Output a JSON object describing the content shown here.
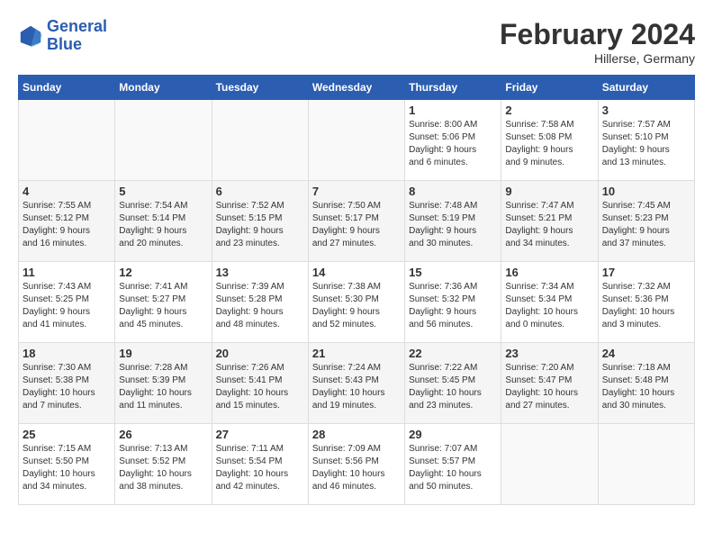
{
  "header": {
    "logo_line1": "General",
    "logo_line2": "Blue",
    "month": "February 2024",
    "location": "Hillerse, Germany"
  },
  "days_of_week": [
    "Sunday",
    "Monday",
    "Tuesday",
    "Wednesday",
    "Thursday",
    "Friday",
    "Saturday"
  ],
  "weeks": [
    [
      {
        "day": "",
        "info": ""
      },
      {
        "day": "",
        "info": ""
      },
      {
        "day": "",
        "info": ""
      },
      {
        "day": "",
        "info": ""
      },
      {
        "day": "1",
        "info": "Sunrise: 8:00 AM\nSunset: 5:06 PM\nDaylight: 9 hours\nand 6 minutes."
      },
      {
        "day": "2",
        "info": "Sunrise: 7:58 AM\nSunset: 5:08 PM\nDaylight: 9 hours\nand 9 minutes."
      },
      {
        "day": "3",
        "info": "Sunrise: 7:57 AM\nSunset: 5:10 PM\nDaylight: 9 hours\nand 13 minutes."
      }
    ],
    [
      {
        "day": "4",
        "info": "Sunrise: 7:55 AM\nSunset: 5:12 PM\nDaylight: 9 hours\nand 16 minutes."
      },
      {
        "day": "5",
        "info": "Sunrise: 7:54 AM\nSunset: 5:14 PM\nDaylight: 9 hours\nand 20 minutes."
      },
      {
        "day": "6",
        "info": "Sunrise: 7:52 AM\nSunset: 5:15 PM\nDaylight: 9 hours\nand 23 minutes."
      },
      {
        "day": "7",
        "info": "Sunrise: 7:50 AM\nSunset: 5:17 PM\nDaylight: 9 hours\nand 27 minutes."
      },
      {
        "day": "8",
        "info": "Sunrise: 7:48 AM\nSunset: 5:19 PM\nDaylight: 9 hours\nand 30 minutes."
      },
      {
        "day": "9",
        "info": "Sunrise: 7:47 AM\nSunset: 5:21 PM\nDaylight: 9 hours\nand 34 minutes."
      },
      {
        "day": "10",
        "info": "Sunrise: 7:45 AM\nSunset: 5:23 PM\nDaylight: 9 hours\nand 37 minutes."
      }
    ],
    [
      {
        "day": "11",
        "info": "Sunrise: 7:43 AM\nSunset: 5:25 PM\nDaylight: 9 hours\nand 41 minutes."
      },
      {
        "day": "12",
        "info": "Sunrise: 7:41 AM\nSunset: 5:27 PM\nDaylight: 9 hours\nand 45 minutes."
      },
      {
        "day": "13",
        "info": "Sunrise: 7:39 AM\nSunset: 5:28 PM\nDaylight: 9 hours\nand 48 minutes."
      },
      {
        "day": "14",
        "info": "Sunrise: 7:38 AM\nSunset: 5:30 PM\nDaylight: 9 hours\nand 52 minutes."
      },
      {
        "day": "15",
        "info": "Sunrise: 7:36 AM\nSunset: 5:32 PM\nDaylight: 9 hours\nand 56 minutes."
      },
      {
        "day": "16",
        "info": "Sunrise: 7:34 AM\nSunset: 5:34 PM\nDaylight: 10 hours\nand 0 minutes."
      },
      {
        "day": "17",
        "info": "Sunrise: 7:32 AM\nSunset: 5:36 PM\nDaylight: 10 hours\nand 3 minutes."
      }
    ],
    [
      {
        "day": "18",
        "info": "Sunrise: 7:30 AM\nSunset: 5:38 PM\nDaylight: 10 hours\nand 7 minutes."
      },
      {
        "day": "19",
        "info": "Sunrise: 7:28 AM\nSunset: 5:39 PM\nDaylight: 10 hours\nand 11 minutes."
      },
      {
        "day": "20",
        "info": "Sunrise: 7:26 AM\nSunset: 5:41 PM\nDaylight: 10 hours\nand 15 minutes."
      },
      {
        "day": "21",
        "info": "Sunrise: 7:24 AM\nSunset: 5:43 PM\nDaylight: 10 hours\nand 19 minutes."
      },
      {
        "day": "22",
        "info": "Sunrise: 7:22 AM\nSunset: 5:45 PM\nDaylight: 10 hours\nand 23 minutes."
      },
      {
        "day": "23",
        "info": "Sunrise: 7:20 AM\nSunset: 5:47 PM\nDaylight: 10 hours\nand 27 minutes."
      },
      {
        "day": "24",
        "info": "Sunrise: 7:18 AM\nSunset: 5:48 PM\nDaylight: 10 hours\nand 30 minutes."
      }
    ],
    [
      {
        "day": "25",
        "info": "Sunrise: 7:15 AM\nSunset: 5:50 PM\nDaylight: 10 hours\nand 34 minutes."
      },
      {
        "day": "26",
        "info": "Sunrise: 7:13 AM\nSunset: 5:52 PM\nDaylight: 10 hours\nand 38 minutes."
      },
      {
        "day": "27",
        "info": "Sunrise: 7:11 AM\nSunset: 5:54 PM\nDaylight: 10 hours\nand 42 minutes."
      },
      {
        "day": "28",
        "info": "Sunrise: 7:09 AM\nSunset: 5:56 PM\nDaylight: 10 hours\nand 46 minutes."
      },
      {
        "day": "29",
        "info": "Sunrise: 7:07 AM\nSunset: 5:57 PM\nDaylight: 10 hours\nand 50 minutes."
      },
      {
        "day": "",
        "info": ""
      },
      {
        "day": "",
        "info": ""
      }
    ]
  ]
}
